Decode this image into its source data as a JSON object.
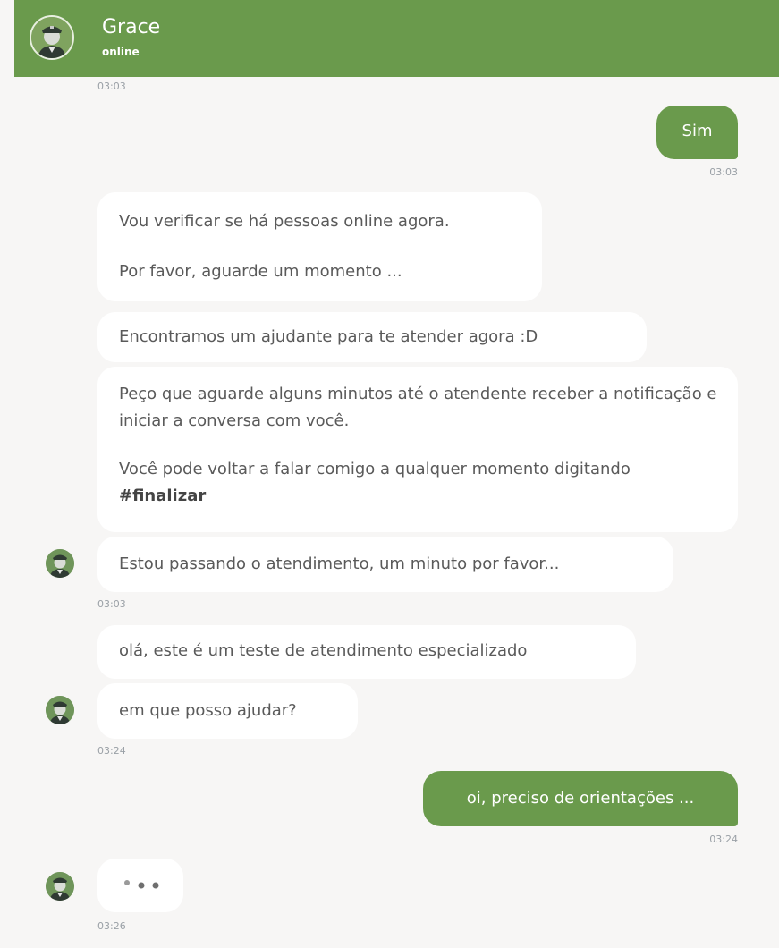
{
  "header": {
    "name": "Grace",
    "status": "online",
    "avatar_icon": "agent-avatar-icon",
    "bg_color": "#6a9a4c"
  },
  "messages": {
    "ts_first": "03:03",
    "user_sim": "Sim",
    "ts_sim": "03:03",
    "verify_line1": "Vou verificar se há pessoas online agora.",
    "verify_line2": "Por favor, aguarde um momento ...",
    "found": "Encontramos um ajudante para te atender agora :D",
    "wait_line1": "Peço que aguarde alguns minutos até o atendente receber a notificação e iniciar a conversa com você.",
    "wait_line2_prefix": "Você pode voltar a falar comigo a qualquer momento digitando ",
    "wait_line2_bold": "#finalizar",
    "passing": "Estou passando o atendimento, um minuto por favor...",
    "ts_passing": "03:03",
    "hello": "olá, este é um teste de atendimento especializado",
    "help": "em que posso ajudar?",
    "ts_help": "03:24",
    "user_oi": "oi, preciso de orientações ...",
    "ts_oi": "03:24",
    "ts_typing": "03:26"
  },
  "colors": {
    "accent": "#6a9a4c",
    "background": "#f7f6f5",
    "incoming_bubble": "#ffffff",
    "incoming_text": "#5a5a5a",
    "timestamp": "#9aa0a6"
  }
}
